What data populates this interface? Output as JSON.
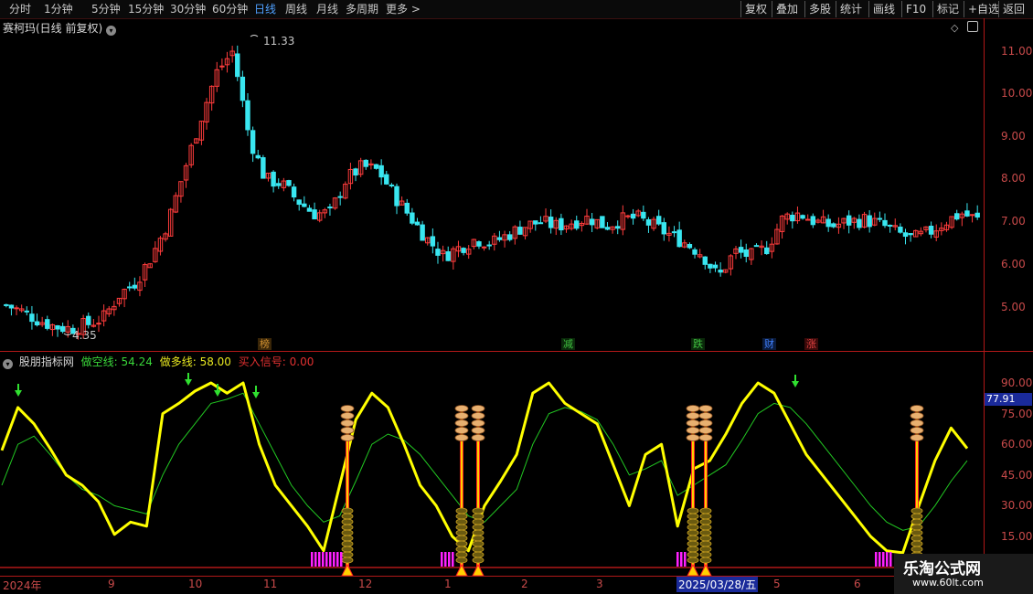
{
  "toolbar": {
    "periods": [
      "分时",
      "1分钟",
      "5分钟",
      "15分钟",
      "30分钟",
      "60分钟",
      "日线",
      "周线",
      "月线",
      "多周期",
      "更多"
    ],
    "active_period": "日线",
    "right_buttons": [
      "复权",
      "叠加",
      "多股",
      "统计",
      "画线",
      "F10",
      "标记",
      "+自选",
      "返回"
    ]
  },
  "main": {
    "title": "赛柯玛(日线 前复权)",
    "high_label": "11.33",
    "low_label": "4.35",
    "price_ticks": [
      "11.00",
      "10.00",
      "9.00",
      "8.00",
      "7.00",
      "6.00",
      "5.00"
    ],
    "events": [
      {
        "text": "榜",
        "color": "#d09030"
      },
      {
        "text": "减",
        "color": "#40c040"
      },
      {
        "text": "跌",
        "color": "#40c040"
      },
      {
        "text": "财",
        "color": "#4080ff"
      },
      {
        "text": "涨",
        "color": "#e04040"
      }
    ]
  },
  "indicator": {
    "name": "股朋指标网",
    "short_label": "做空线: 54.24",
    "long_label": "做多线: 58.00",
    "signal_label": "买入信号: 0.00",
    "current_value": "77.91",
    "ticks": [
      "90.00",
      "75.00",
      "60.00",
      "45.00",
      "30.00",
      "15.00"
    ]
  },
  "dates": [
    "2024年",
    "9",
    "10",
    "11",
    "12",
    "1",
    "2",
    "3",
    "2025/03/28/五",
    "5",
    "6"
  ],
  "watermark": {
    "name": "乐淘公式网",
    "url": "www.60lt.com"
  },
  "colors": {
    "up": "#ff3c3c",
    "down": "#39e6f0",
    "short_line": "#ffff00",
    "long_line": "#22c822",
    "axis": "#b01818"
  },
  "chart_data": {
    "type": "candlestick+line",
    "title": "赛柯玛(日线 前复权)",
    "price_range": [
      4.35,
      11.33
    ],
    "close_path": [
      5.05,
      4.9,
      4.7,
      4.55,
      4.5,
      4.6,
      4.75,
      5.3,
      5.6,
      6.2,
      7.0,
      8.2,
      9.4,
      10.5,
      11.0,
      9.0,
      8.0,
      7.9,
      7.5,
      7.2,
      7.2,
      8.0,
      8.3,
      8.2,
      7.6,
      7.1,
      6.6,
      6.2,
      6.4,
      6.6,
      6.5,
      6.7,
      6.9,
      7.0,
      6.9,
      7.0,
      7.1,
      6.9,
      7.05,
      7.1,
      6.9,
      6.7,
      6.5,
      6.25,
      5.7,
      6.3,
      6.2,
      6.4,
      7.1,
      7.2,
      7.0,
      6.9,
      7.0,
      7.05,
      6.95,
      6.75,
      6.6,
      6.75,
      7.0,
      7.2,
      7.05
    ],
    "indicator": {
      "name": "股朋指标网",
      "range": [
        0,
        100
      ],
      "series": [
        {
          "name": "做空线",
          "last": 54.24,
          "values": [
            57,
            78,
            70,
            58,
            45,
            40,
            32,
            16,
            22,
            20,
            75,
            80,
            86,
            90,
            85,
            90,
            60,
            40,
            30,
            20,
            8,
            40,
            72,
            85,
            78,
            60,
            40,
            30,
            15,
            8,
            30,
            42,
            55,
            85,
            90,
            80,
            75,
            70,
            50,
            30,
            55,
            60,
            20,
            48,
            52,
            65,
            80,
            90,
            85,
            70,
            55,
            45,
            35,
            25,
            15,
            8,
            7,
            30,
            52,
            68,
            58
          ]
        },
        {
          "name": "做多线",
          "last": 58.0,
          "values": [
            40,
            60,
            64,
            55,
            45,
            38,
            35,
            30,
            28,
            26,
            45,
            60,
            70,
            80,
            82,
            85,
            70,
            55,
            40,
            30,
            22,
            25,
            42,
            60,
            65,
            62,
            55,
            45,
            35,
            25,
            22,
            30,
            38,
            60,
            75,
            78,
            76,
            72,
            60,
            45,
            48,
            52,
            35,
            40,
            45,
            50,
            62,
            75,
            80,
            78,
            70,
            60,
            50,
            40,
            30,
            22,
            18,
            20,
            30,
            42,
            52
          ]
        }
      ],
      "buy_signal": 0.0,
      "current_value": 77.91
    }
  }
}
